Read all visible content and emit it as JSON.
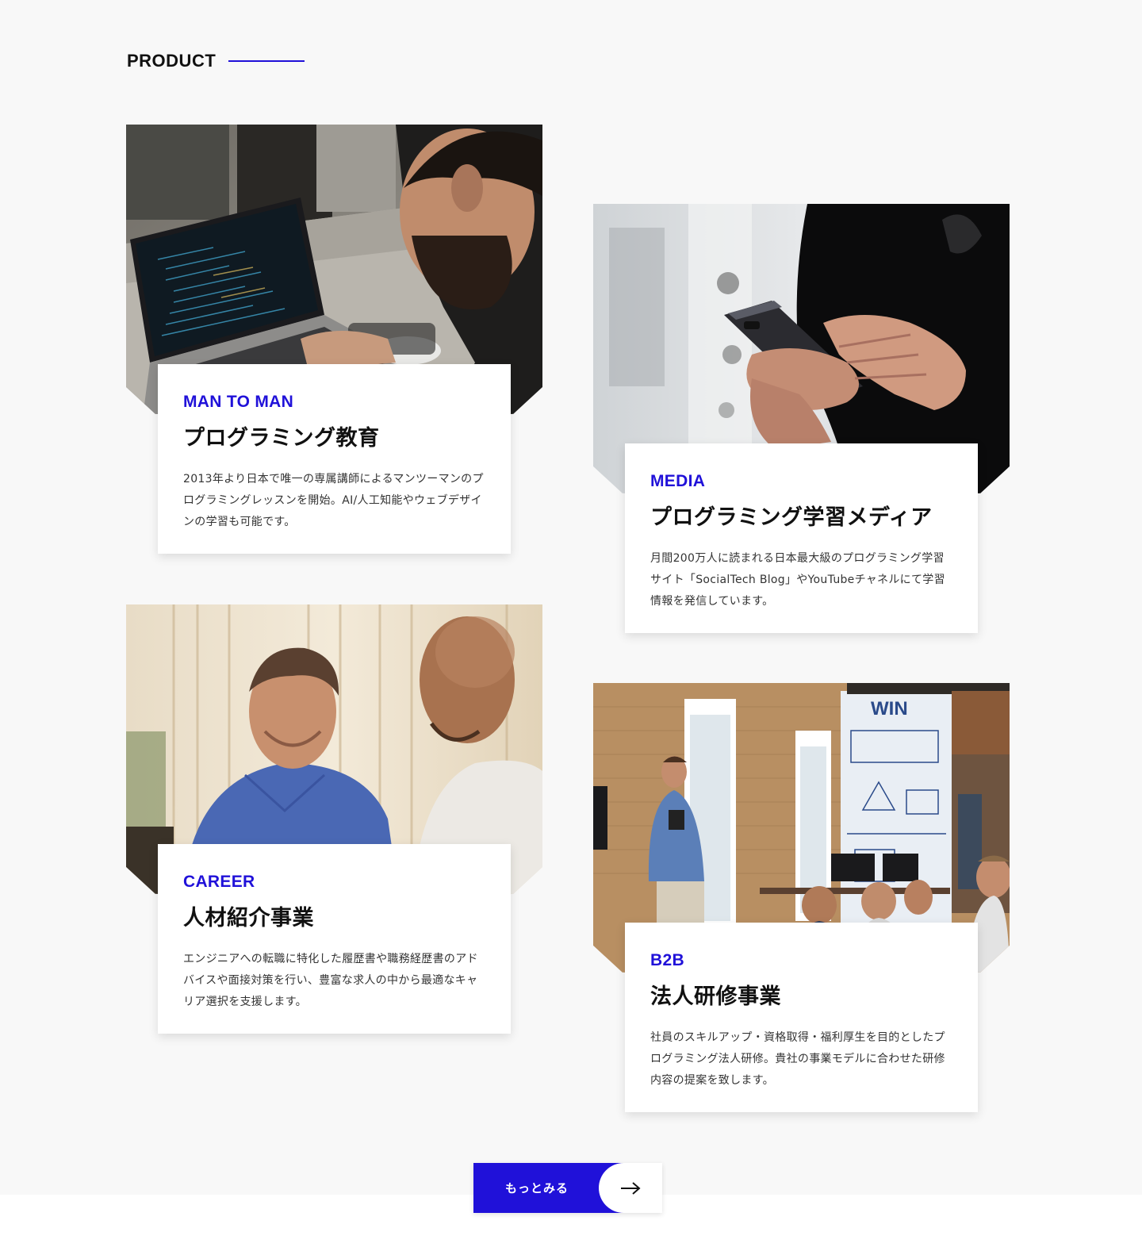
{
  "section": {
    "heading": "PRODUCT",
    "accent_color": "#2011d9"
  },
  "products": [
    {
      "label": "MAN TO MAN",
      "title": "プログラミング教育",
      "description": "2013年より日本で唯一の専属講師によるマンツーマンのプログラミングレッスンを開始。AI/人工知能やウェブデザインの学習も可能です。",
      "image": "person-coding-on-laptop-photo"
    },
    {
      "label": "MEDIA",
      "title": "プログラミング学習メディア",
      "description": "月間200万人に読まれる日本最大級のプログラミング学習サイト「SocialTech Blog」やYouTubeチャネルにて学習情報を発信しています。",
      "image": "hands-holding-smartphone-photo"
    },
    {
      "label": "CAREER",
      "title": "人材紹介事業",
      "description": "エンジニアへの転職に特化した履歴書や職務経歴書のアドバイスや面接対策を行い、豊富な求人の中から最適なキャリア選択を支援します。",
      "image": "two-men-consulting-photo"
    },
    {
      "label": "B2B",
      "title": "法人研修事業",
      "description": "社員のスキルアップ・資格取得・福利厚生を目的としたプログラミング法人研修。貴社の事業モデルに合わせた研修内容の提案を致します。",
      "image": "corporate-training-presentation-photo",
      "wall_text": "WIN"
    }
  ],
  "more_button": {
    "label": "もっとみる",
    "icon": "arrow-right-icon"
  }
}
